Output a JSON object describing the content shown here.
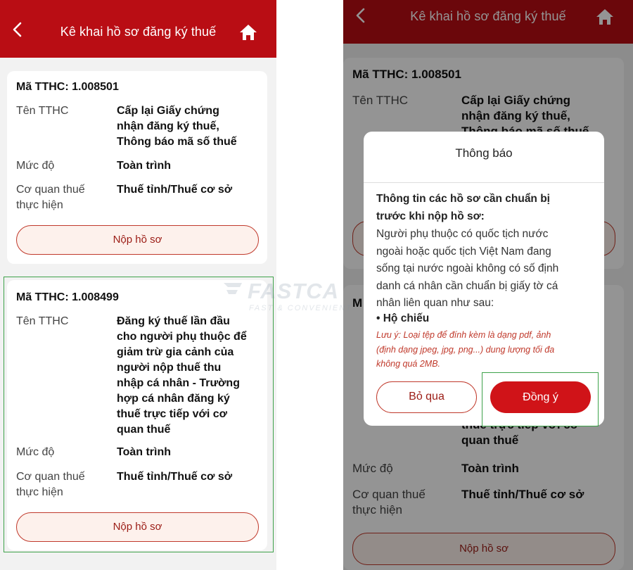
{
  "header": {
    "title": "Kê khai hồ sơ đăng ký thuế"
  },
  "labels": {
    "name": "Tên TTHC",
    "level": "Mức độ",
    "agency_line1": "Cơ quan thuế",
    "agency_line2": "thực hiện"
  },
  "cards": [
    {
      "code": "Mã TTHC: 1.008501",
      "name_lines": [
        "Cấp lại Giấy chứng",
        "nhận đăng ký thuế,",
        "Thông báo mã số thuế"
      ],
      "level": "Toàn trình",
      "agency": "Thuế tỉnh/Thuế cơ sở",
      "button": "Nộp hồ sơ"
    },
    {
      "code": "Mã TTHC: 1.008499",
      "name_lines": [
        "Đăng ký thuế lần đầu",
        "cho người phụ thuộc để",
        "giảm trừ gia cảnh của",
        "người nộp thuế thu",
        "nhập cá nhân - Trường",
        "hợp cá nhân đăng ký",
        "thuế trực tiếp với cơ",
        "quan thuế"
      ],
      "level": "Toàn trình",
      "agency": "Thuế tỉnh/Thuế cơ sở",
      "button": "Nộp hồ sơ"
    }
  ],
  "right_background": {
    "peek_name_lines": [
      "Cấp lại Giấy chứng",
      "nhận đăng ký thuế,",
      "Thông báo mã số thuế"
    ],
    "peek_tail_lines": [
      "thuế trực tiếp với cơ",
      "quan thuế"
    ],
    "peek_code_short": "M"
  },
  "dialog": {
    "title": "Thông báo",
    "heading_lines": [
      "Thông tin các hồ sơ cần chuẩn bị",
      "trước khi nộp hồ sơ:"
    ],
    "body_lines": [
      "Người phụ thuộc có quốc tịch nước",
      "ngoài hoặc quốc tịch Việt Nam đang",
      "sống tại nước ngoài không có số định",
      "danh cá nhân cần chuẩn bị giấy tờ cá",
      "nhân liên quan như sau:"
    ],
    "bullet": "• Hộ chiếu",
    "note_lines": [
      "Lưu ý: Loại tệp để đính kèm là dạng pdf, ảnh",
      "(định dạng jpeg, jpg, png...) dung lượng tối đa",
      "không quá 2MB."
    ],
    "cancel": "Bỏ qua",
    "confirm": "Đồng ý"
  },
  "watermark": {
    "brand": "FASTCA",
    "tagline": "FAST & CONVENIENT"
  },
  "colors": {
    "header": "#b90d14",
    "accent": "#d01318",
    "highlight": "#3ea24a"
  },
  "icons": [
    "back-arrow-icon",
    "home-icon"
  ]
}
